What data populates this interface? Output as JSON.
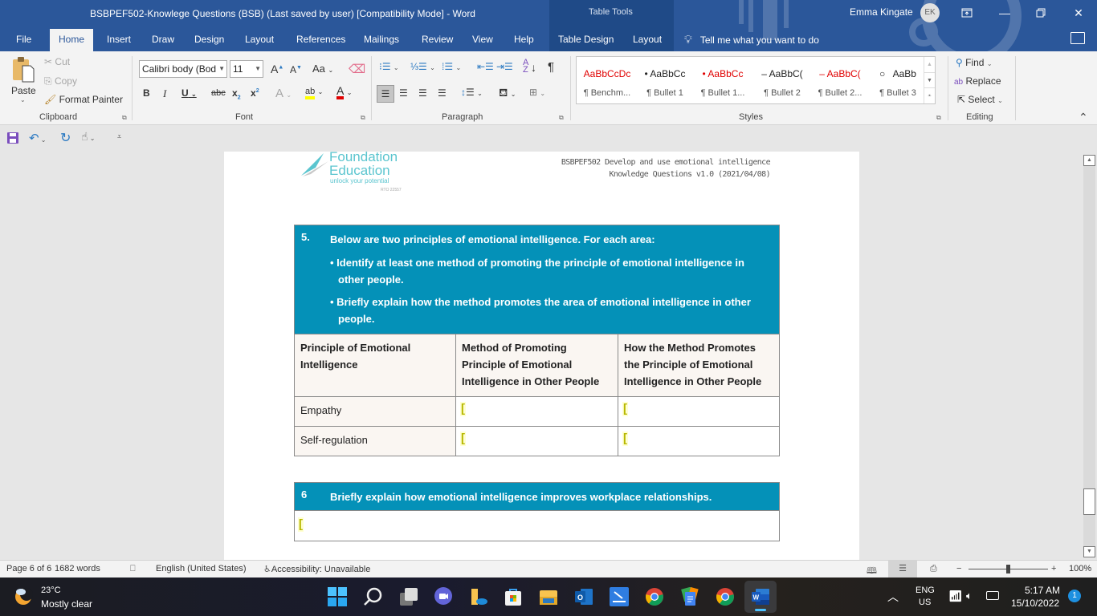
{
  "window": {
    "title": "BSBPEF502-Knowlege Questions (BSB) (Last saved by user) [Compatibility Mode]  -  Word",
    "contextual_group": "Table Tools",
    "user_name": "Emma Kingate",
    "user_initials": "EK"
  },
  "ribbon_tabs": [
    {
      "label": "File"
    },
    {
      "label": "Home",
      "active": true
    },
    {
      "label": "Insert"
    },
    {
      "label": "Draw"
    },
    {
      "label": "Design"
    },
    {
      "label": "Layout"
    },
    {
      "label": "References"
    },
    {
      "label": "Mailings"
    },
    {
      "label": "Review"
    },
    {
      "label": "View"
    },
    {
      "label": "Help"
    },
    {
      "label": "Table Design"
    },
    {
      "label": "Layout"
    }
  ],
  "tell_me": "Tell me what you want to do",
  "clipboard": {
    "paste": "Paste",
    "cut": "Cut",
    "copy": "Copy",
    "format_painter": "Format Painter",
    "group_label": "Clipboard"
  },
  "font": {
    "font_name": "Calibri body (Bod",
    "font_size": "11",
    "group_label": "Font",
    "highlight_color": "#ffff00",
    "font_color": "#e00000"
  },
  "paragraph": {
    "group_label": "Paragraph"
  },
  "styles": {
    "group_label": "Styles",
    "items": [
      {
        "preview": "AaBbCcDc",
        "bullet": "",
        "name": "¶ Benchm...",
        "color": "#e00000"
      },
      {
        "preview": "AaBbCc",
        "bullet": "•",
        "name": "¶ Bullet 1",
        "color": "#222222"
      },
      {
        "preview": "AaBbCc",
        "bullet": "•",
        "name": "¶ Bullet 1...",
        "color": "#e00000"
      },
      {
        "preview": "AaBbC(",
        "bullet": "–",
        "name": "¶ Bullet 2",
        "color": "#222222"
      },
      {
        "preview": "AaBbC(",
        "bullet": "–",
        "name": "¶ Bullet 2...",
        "color": "#e00000"
      },
      {
        "preview": "AaBb",
        "bullet": "○",
        "name": "¶ Bullet 3",
        "color": "#222222"
      }
    ]
  },
  "editing": {
    "find": "Find",
    "replace": "Replace",
    "select": "Select",
    "group_label": "Editing"
  },
  "document": {
    "logo_line1": "Foundation",
    "logo_line2": "Education",
    "logo_tagline": "unlock your potential",
    "logo_rto": "RTO 22557",
    "header_line1": "BSBPEF502 Develop and use emotional intelligence",
    "header_line2": "Knowledge Questions v1.0 (2021/04/08)",
    "q5": {
      "number": "5.",
      "prompt": "Below are two principles of emotional intelligence. For each area:",
      "bullets": [
        "• Identify at least one method of promoting the principle of emotional intelligence in other people.",
        "• Briefly explain how the method promotes the area of emotional intelligence in other people."
      ],
      "columns": [
        "Principle of Emotional Intelligence",
        "Method of Promoting Principle of Emotional Intelligence in Other People",
        "How the Method Promotes the Principle of Emotional Intelligence in Other People"
      ],
      "rows": [
        {
          "principle": "Empathy",
          "method": "[",
          "how": "["
        },
        {
          "principle": "Self-regulation",
          "method": "[",
          "how": "["
        }
      ]
    },
    "q6": {
      "number": "6",
      "prompt": "Briefly explain how emotional intelligence improves workplace relationships.",
      "answer": "["
    }
  },
  "status_bar": {
    "page": "Page 6 of 6",
    "words": "1682 words",
    "language": "English (United States)",
    "accessibility": "Accessibility: Unavailable",
    "zoom": "100%",
    "zoom_value_percent": 100
  },
  "taskbar": {
    "temperature": "23°C",
    "weather": "Mostly clear",
    "lang_line1": "ENG",
    "lang_line2": "US",
    "time": "5:17 AM",
    "date": "15/10/2022",
    "notification_count": "1"
  },
  "colors": {
    "word_blue": "#2b579a",
    "question_header": "#0491b8",
    "table_header_bg": "#faf6f2"
  }
}
